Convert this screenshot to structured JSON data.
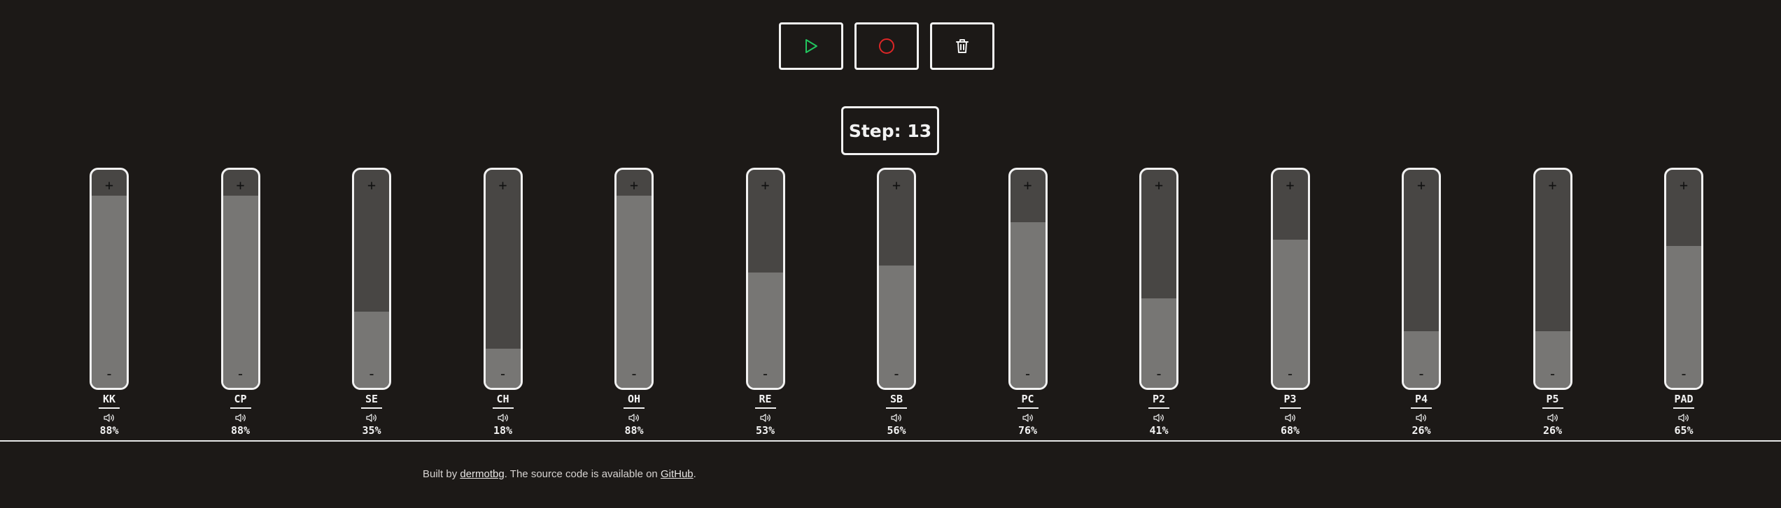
{
  "transport": {
    "play": {
      "icon": "play-icon",
      "color": "#22c55e"
    },
    "record": {
      "icon": "record-icon",
      "color": "#dc2626"
    },
    "clear": {
      "icon": "trash-icon",
      "color": "#f2f2f2"
    }
  },
  "step_text": "Step: 13",
  "fader_controls": {
    "plus": "+",
    "minus": "-"
  },
  "channels": [
    {
      "label": "KK",
      "level": 0.88,
      "percent": "88%"
    },
    {
      "label": "CP",
      "level": 0.88,
      "percent": "88%"
    },
    {
      "label": "SE",
      "level": 0.35,
      "percent": "35%"
    },
    {
      "label": "CH",
      "level": 0.18,
      "percent": "18%"
    },
    {
      "label": "OH",
      "level": 0.88,
      "percent": "88%"
    },
    {
      "label": "RE",
      "level": 0.53,
      "percent": "53%"
    },
    {
      "label": "SB",
      "level": 0.56,
      "percent": "56%"
    },
    {
      "label": "PC",
      "level": 0.76,
      "percent": "76%"
    },
    {
      "label": "P2",
      "level": 0.41,
      "percent": "41%"
    },
    {
      "label": "P3",
      "level": 0.68,
      "percent": "68%"
    },
    {
      "label": "P4",
      "level": 0.26,
      "percent": "26%"
    },
    {
      "label": "P5",
      "level": 0.26,
      "percent": "26%"
    },
    {
      "label": "PAD",
      "level": 0.65,
      "percent": "65%"
    }
  ],
  "footer": {
    "prefix": "Built by ",
    "author_link": "dermotbg",
    "middle": ". The source code is available on ",
    "repo_link": "GitHub",
    "suffix": "."
  },
  "colors": {
    "background": "#1c1917",
    "fader_track": "#484644",
    "fader_fill": "#777674",
    "border": "#f2f2f2"
  }
}
